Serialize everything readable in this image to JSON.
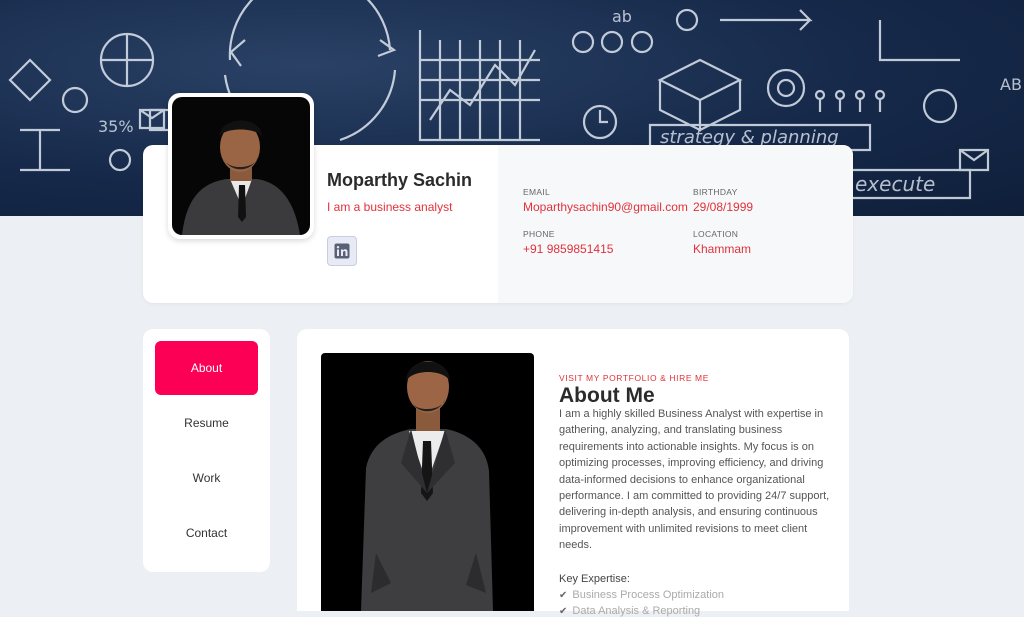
{
  "profile": {
    "name": "Moparthy Sachin",
    "tagline": "I am a business analyst",
    "contacts": [
      {
        "label": "EMAIL",
        "value": "Moparthysachin90@gmail.com"
      },
      {
        "label": "BIRTHDAY",
        "value": "29/08/1999"
      },
      {
        "label": "PHONE",
        "value": "+91 9859851415"
      },
      {
        "label": "LOCATION",
        "value": "Khammam"
      }
    ],
    "social": [
      "linkedin-icon"
    ]
  },
  "banner": {
    "texts": [
      "strategy & planning",
      "execute",
      "35%",
      "ab",
      "AB"
    ]
  },
  "nav": {
    "items": [
      {
        "label": "About",
        "active": true
      },
      {
        "label": "Resume",
        "active": false
      },
      {
        "label": "Work",
        "active": false
      },
      {
        "label": "Contact",
        "active": false
      }
    ]
  },
  "about": {
    "kicker": "VISIT MY PORTFOLIO & HIRE ME",
    "title": "About Me",
    "body": "I am a highly skilled Business Analyst with expertise in gathering, analyzing, and translating business requirements into actionable insights. My focus is on optimizing processes, improving efficiency, and driving data-informed decisions to enhance organizational performance. I am committed to providing 24/7 support, delivering in-depth analysis, and ensuring continuous improvement with unlimited revisions to meet client needs.",
    "expertise_heading": "Key Expertise:",
    "expertise": [
      "Business Process Optimization",
      "Data Analysis & Reporting"
    ]
  },
  "colors": {
    "accent": "#e0323b",
    "nav_active": "#fb0055",
    "banner": "#16294a"
  }
}
